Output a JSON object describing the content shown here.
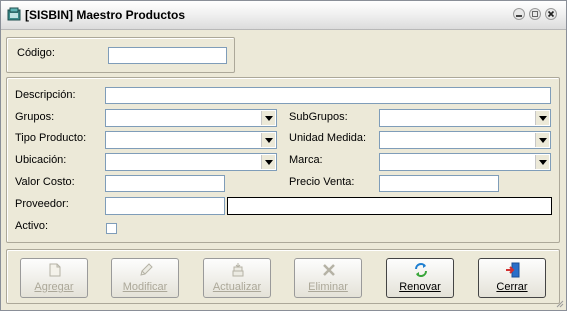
{
  "window": {
    "title": "[SISBIN] Maestro Productos"
  },
  "form": {
    "codigo_label": "Código:",
    "codigo_value": "",
    "descripcion_label": "Descripción:",
    "grupos_label": "Grupos:",
    "subgrupos_label": "SubGrupos:",
    "tipo_producto_label": "Tipo Producto:",
    "unidad_medida_label": "Unidad Medida:",
    "ubicacion_label": "Ubicación:",
    "marca_label": "Marca:",
    "valor_costo_label": "Valor Costo:",
    "precio_venta_label": "Precio Venta:",
    "proveedor_label": "Proveedor:",
    "activo_label": "Activo:"
  },
  "buttons": [
    {
      "label": "Agregar",
      "enabled": false,
      "icon": "new-doc-icon"
    },
    {
      "label": "Modificar",
      "enabled": false,
      "icon": "pencil-icon"
    },
    {
      "label": "Actualizar",
      "enabled": false,
      "icon": "stack-icon"
    },
    {
      "label": "Eliminar",
      "enabled": false,
      "icon": "cross-tools-icon"
    },
    {
      "label": "Renovar",
      "enabled": true,
      "icon": "refresh-icon"
    },
    {
      "label": "Cerrar",
      "enabled": true,
      "icon": "exit-door-icon"
    }
  ]
}
